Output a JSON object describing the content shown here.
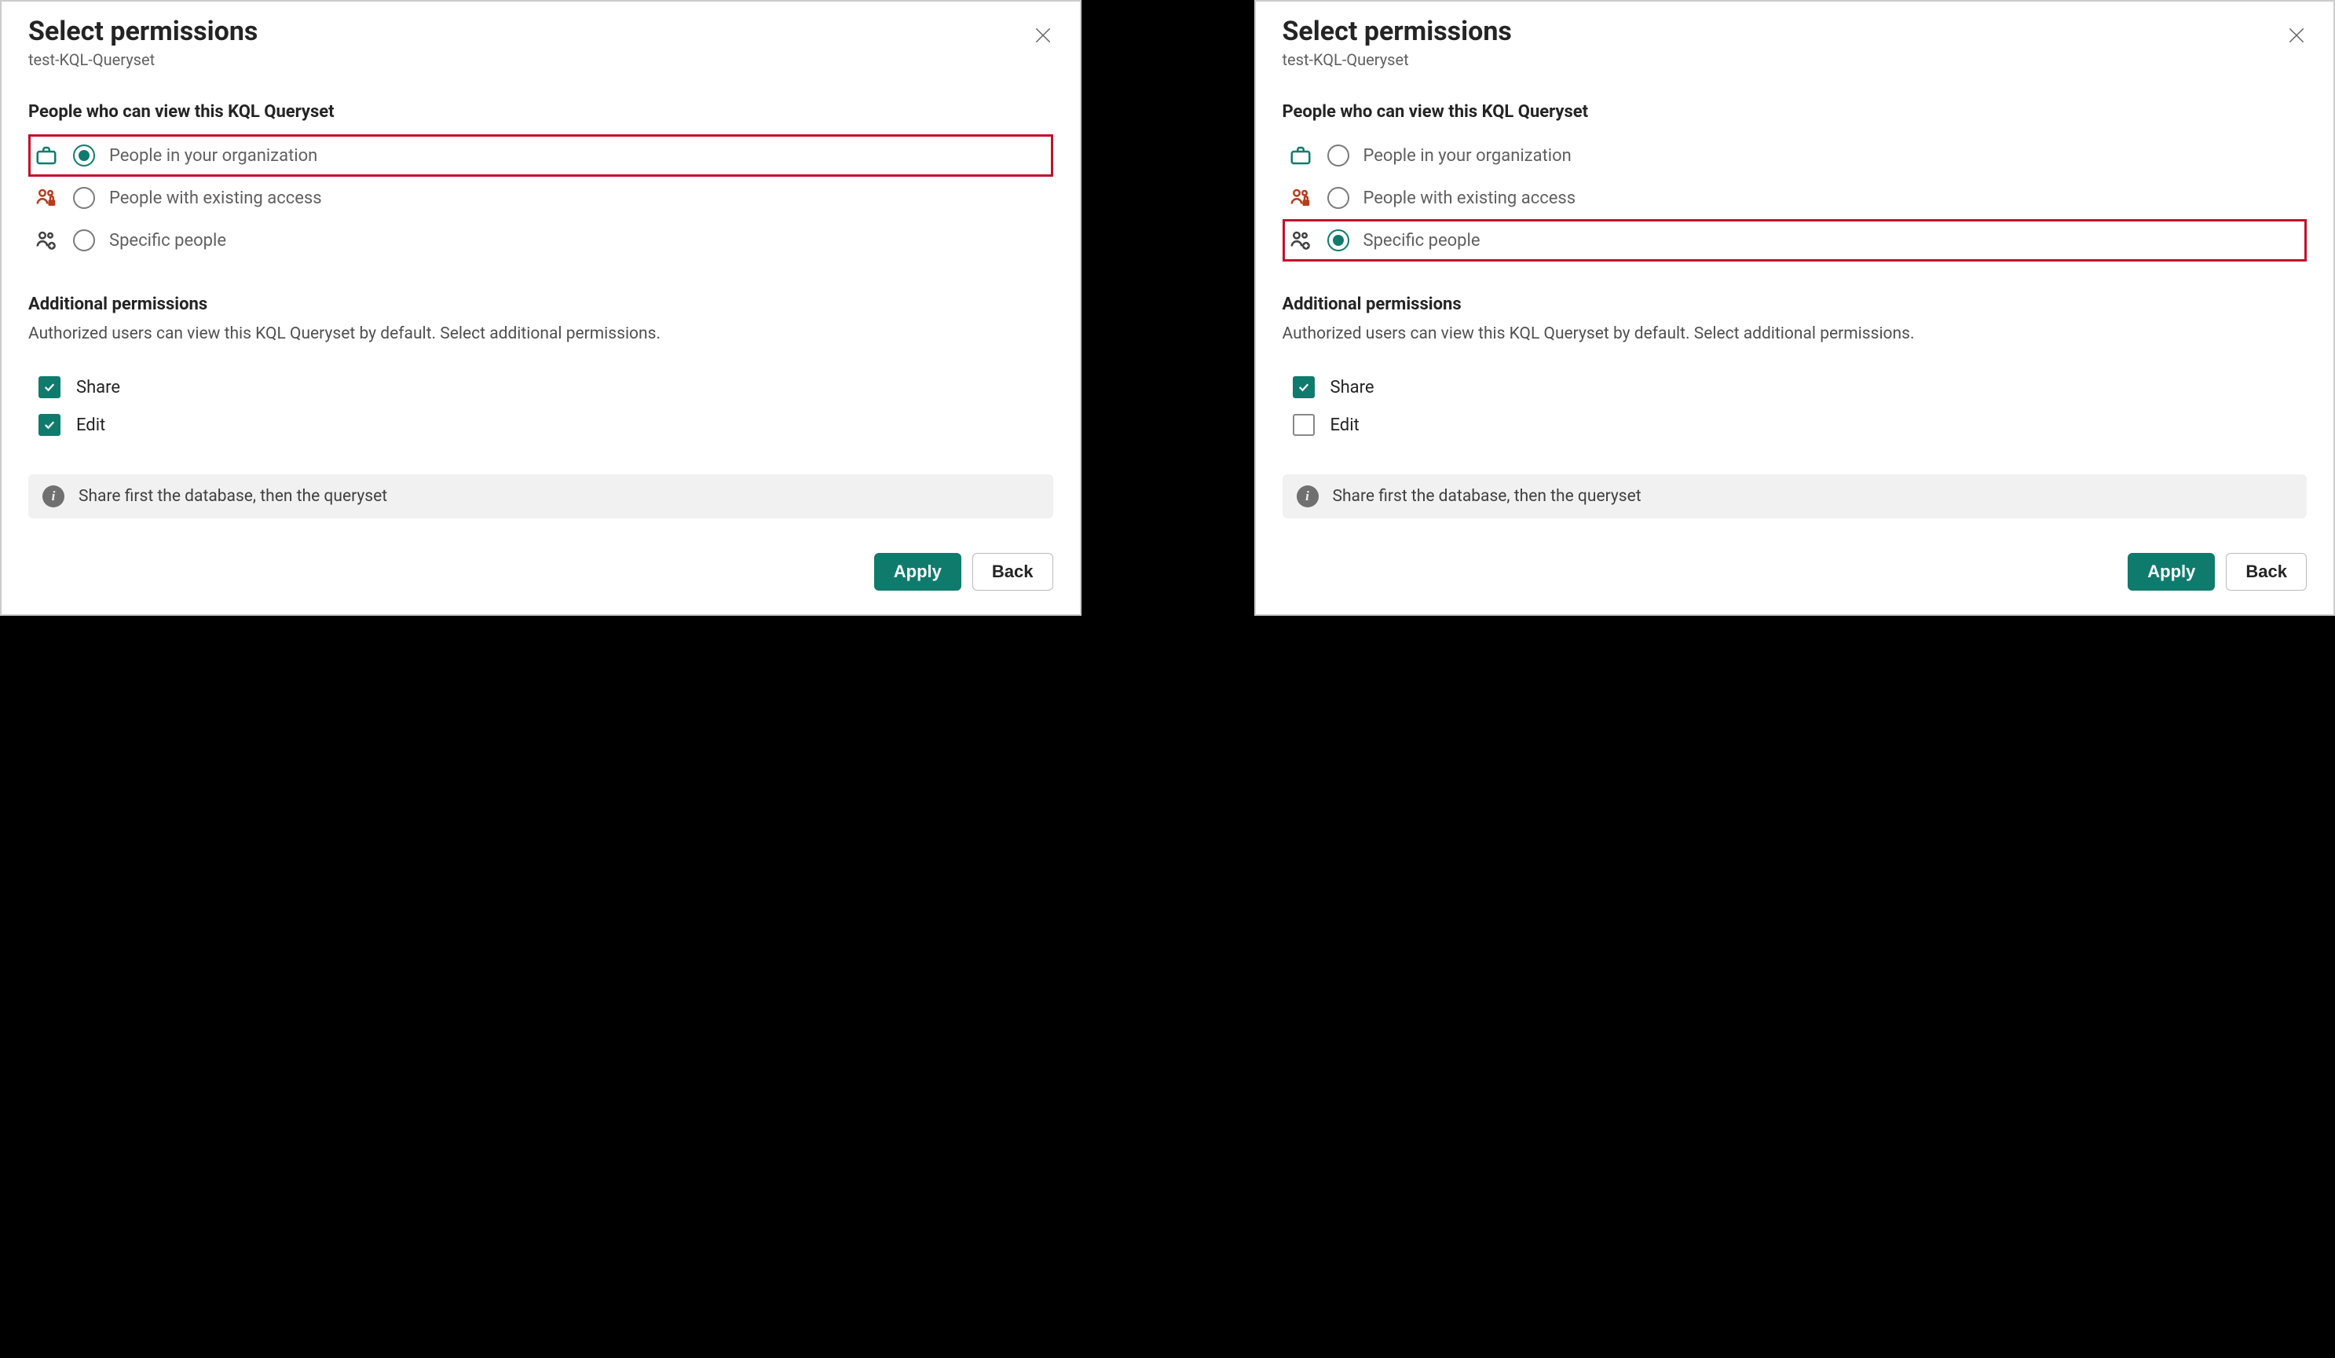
{
  "title": "Select permissions",
  "subtitle": "test-KQL-Queryset",
  "section_view_heading": "People who can view this KQL Queryset",
  "options": {
    "org": "People in your organization",
    "existing": "People with existing access",
    "specific": "Specific people"
  },
  "section_additional_heading": "Additional permissions",
  "additional_desc": "Authorized users can view this KQL Queryset by default. Select additional permissions.",
  "perm_share": "Share",
  "perm_edit": "Edit",
  "info_text": "Share first the database, then the queryset",
  "btn_apply": "Apply",
  "btn_back": "Back",
  "left": {
    "selected_option": "org",
    "share_checked": true,
    "edit_checked": true,
    "highlight_option": "org"
  },
  "right": {
    "selected_option": "specific",
    "share_checked": true,
    "edit_checked": false,
    "highlight_option": "specific"
  }
}
